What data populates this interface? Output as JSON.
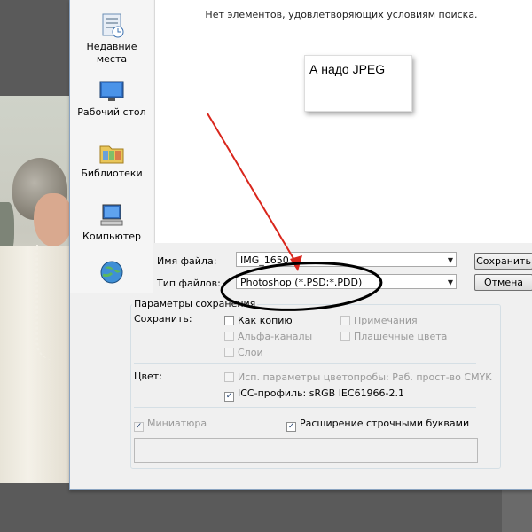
{
  "places": [
    {
      "label": "Недавние места",
      "icon": "recent-places-icon"
    },
    {
      "label": "Рабочий стол",
      "icon": "desktop-icon"
    },
    {
      "label": "Библиотеки",
      "icon": "libraries-icon"
    },
    {
      "label": "Компьютер",
      "icon": "computer-icon"
    },
    {
      "label": "",
      "icon": "network-icon"
    }
  ],
  "filelist": {
    "empty_message": "Нет элементов, удовлетворяющих условиям поиска."
  },
  "note": {
    "text": "А надо JPEG"
  },
  "form": {
    "filename_label": "Имя файла:",
    "filename_value": "IMG_1650",
    "filetype_label": "Тип файлов:",
    "filetype_value": "Photoshop (*.PSD;*.PDD)",
    "save_button": "Сохранить",
    "cancel_button": "Отмена"
  },
  "options": {
    "group_title": "Параметры сохранения",
    "save_label": "Сохранить:",
    "as_copy": "Как копию",
    "notes": "Примечания",
    "alpha": "Альфа-каналы",
    "spot": "Плашечные цвета",
    "layers": "Слои",
    "color_label": "Цвет:",
    "proof": "Исп. параметры цветопробы:  Раб. прост-во CMYK",
    "icc": "ICC-профиль:  sRGB IEC61966-2.1",
    "thumbnail": "Миниатюра",
    "lowercase_ext": "Расширение строчными буквами"
  },
  "colors": {
    "annotation_arrow": "#d9261c",
    "circle": "#000000",
    "dialog_bg": "#f0f0f0"
  }
}
